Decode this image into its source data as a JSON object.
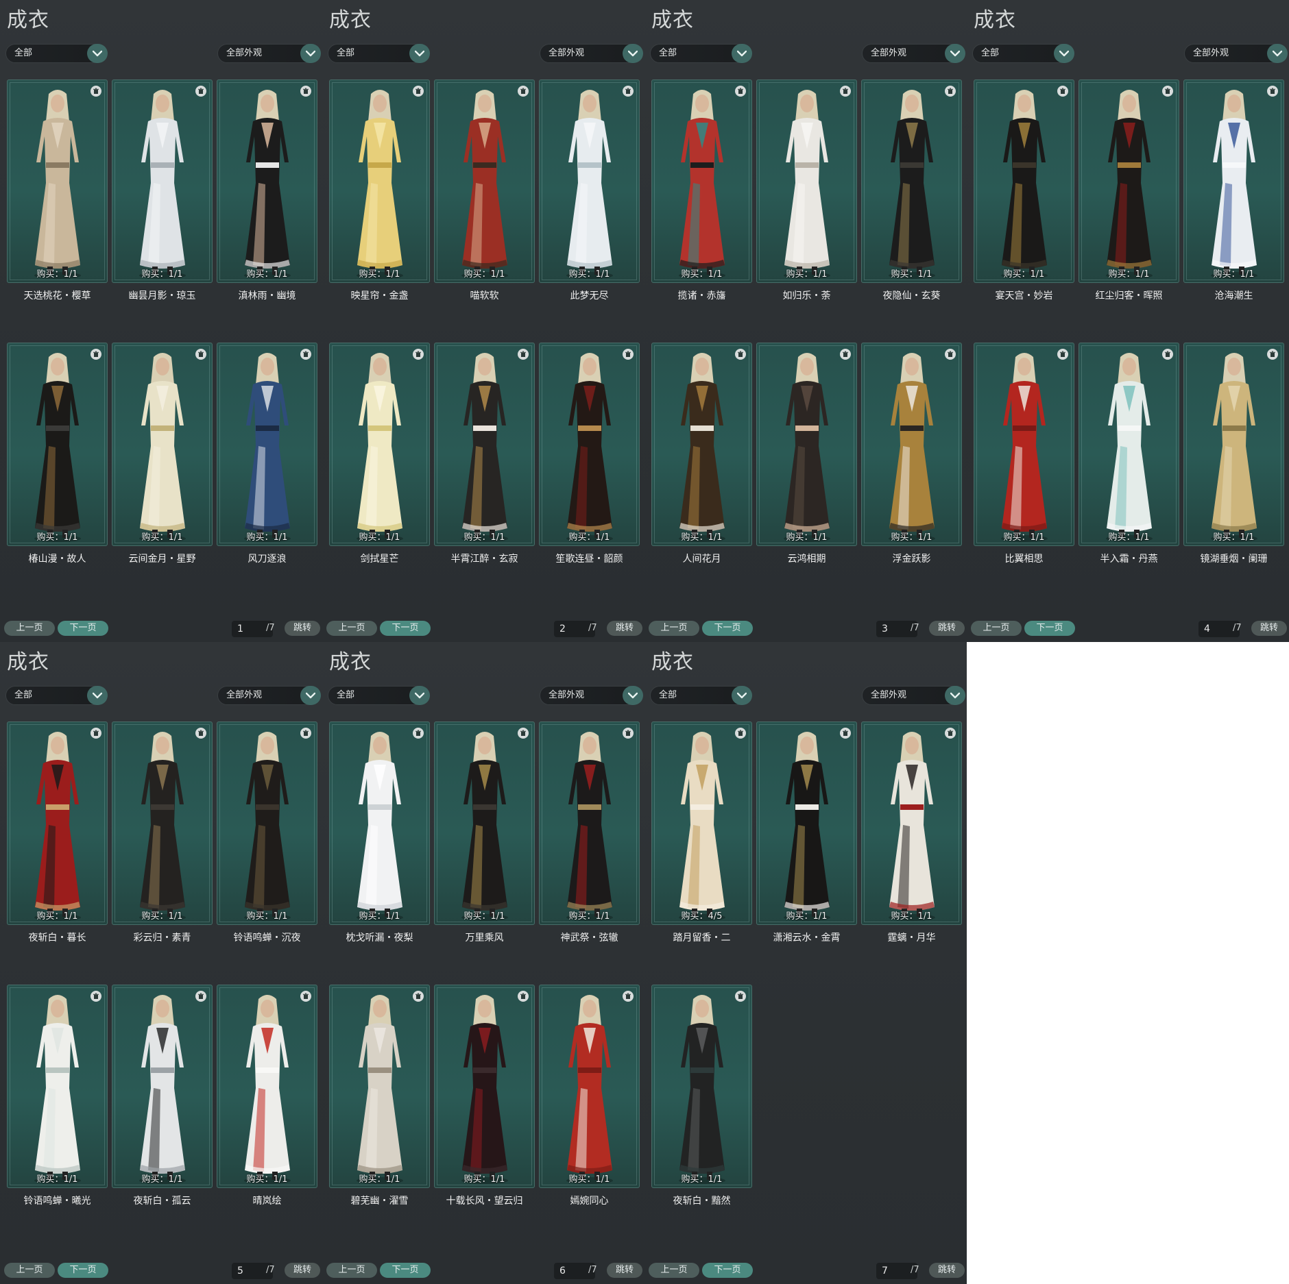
{
  "panels": [
    {
      "title": "成衣",
      "filter_left": "全部",
      "filter_right": "全部外观",
      "items": [
        {
          "name": "天选桃花・樱草",
          "buy": "购买：1/1",
          "palette": [
            "#c9b79b",
            "#e2d5bf",
            "#8a7a62"
          ]
        },
        {
          "name": "幽昙月影・琼玉",
          "buy": "购买：1/1",
          "palette": [
            "#dfe3e6",
            "#f3f5f6",
            "#a9b1b6"
          ]
        },
        {
          "name": "滇林雨・幽境",
          "buy": "购买：1/1",
          "palette": [
            "#1c1c1c",
            "#d9b79c",
            "#e6e6e6"
          ]
        },
        {
          "name": "椿山漫・故人",
          "buy": "购买：1/1",
          "palette": [
            "#1b1a18",
            "#8c6a3a",
            "#3a3a38"
          ]
        },
        {
          "name": "云间金月・星野",
          "buy": "购买：1/1",
          "palette": [
            "#e8e2c8",
            "#f3efdf",
            "#c2b27a"
          ]
        },
        {
          "name": "风刀逐浪",
          "buy": "购买：1/1",
          "palette": [
            "#2f4d7a",
            "#d7dde3",
            "#1b2b44"
          ]
        }
      ],
      "prev_label": "上一页",
      "next_label": "下一页",
      "page": "1",
      "total": "/7",
      "jump_label": "跳转"
    },
    {
      "title": "成衣",
      "filter_left": "全部",
      "filter_right": "全部外观",
      "items": [
        {
          "name": "映星帘・金盏",
          "buy": "购买：1/1",
          "palette": [
            "#e7cf7a",
            "#f4e6a8",
            "#c6a84a"
          ]
        },
        {
          "name": "喵软软",
          "buy": "购买：1/1",
          "palette": [
            "#9b2f24",
            "#d7a98a",
            "#3b2a20"
          ]
        },
        {
          "name": "此梦无尽",
          "buy": "购买：1/1",
          "palette": [
            "#e7ecef",
            "#f6f8f9",
            "#b5c3c9"
          ]
        },
        {
          "name": "剑拭星芒",
          "buy": "购买：1/1",
          "palette": [
            "#efe9c4",
            "#faf6e2",
            "#d4c67c"
          ]
        },
        {
          "name": "半霄江醉・玄寂",
          "buy": "购买：1/1",
          "palette": [
            "#272523",
            "#b08a4a",
            "#e9e3dc"
          ]
        },
        {
          "name": "笙歌连昼・韶颜",
          "buy": "购买：1/1",
          "palette": [
            "#231915",
            "#7a1e1a",
            "#b68a4e"
          ]
        }
      ],
      "prev_label": "上一页",
      "next_label": "下一页",
      "page": "2",
      "total": "/7",
      "jump_label": "跳转"
    },
    {
      "title": "成衣",
      "filter_left": "全部",
      "filter_right": "全部外观",
      "items": [
        {
          "name": "揽诸・赤旛",
          "buy": "购买：1/1",
          "palette": [
            "#b3332c",
            "#2f8a86",
            "#1d1d1d"
          ]
        },
        {
          "name": "如归乐・荼",
          "buy": "购买：1/1",
          "palette": [
            "#e9e7e2",
            "#f7f6f3",
            "#b9b3a8"
          ]
        },
        {
          "name": "夜隐仙・玄葵",
          "buy": "购买：1/1",
          "palette": [
            "#1c1c1c",
            "#8e7a4a",
            "#3a3833"
          ]
        },
        {
          "name": "人间花月",
          "buy": "购买：1/1",
          "palette": [
            "#3a2b1c",
            "#a37a3c",
            "#e5dfd3"
          ]
        },
        {
          "name": "云鸿相期",
          "buy": "购买：1/1",
          "palette": [
            "#2c2623",
            "#5a4a40",
            "#d3b59b"
          ]
        },
        {
          "name": "浮金跃影",
          "buy": "购买：1/1",
          "palette": [
            "#a8823c",
            "#ece8de",
            "#2a2622"
          ]
        }
      ],
      "prev_label": "上一页",
      "next_label": "下一页",
      "page": "3",
      "total": "/7",
      "jump_label": "跳转"
    },
    {
      "title": "成衣",
      "filter_left": "全部",
      "filter_right": "全部外观",
      "items": [
        {
          "name": "宴天宫・妙岩",
          "buy": "购买：1/1",
          "palette": [
            "#1a1918",
            "#a0803c",
            "#3a342a"
          ]
        },
        {
          "name": "红尘归客・晖照",
          "buy": "购买：1/1",
          "palette": [
            "#1d1a18",
            "#8a1e1c",
            "#a07a3a"
          ]
        },
        {
          "name": "沧海潮生",
          "buy": "购买：1/1",
          "palette": [
            "#e9edf1",
            "#3c5a9a",
            "#f6f8fa"
          ]
        },
        {
          "name": "比翼相思",
          "buy": "购买：1/1",
          "palette": [
            "#b3261f",
            "#ece5dc",
            "#7a1a16"
          ]
        },
        {
          "name": "半入霜・丹燕",
          "buy": "购买：1/1",
          "palette": [
            "#e4ece9",
            "#7fc2bd",
            "#f5f7f6"
          ]
        },
        {
          "name": "镜湖垂烟・阑珊",
          "buy": "购买：1/1",
          "palette": [
            "#cdb57c",
            "#e4d6b0",
            "#8c7a4a"
          ]
        }
      ],
      "prev_label": "上一页",
      "next_label": "下一页",
      "page": "4",
      "total": "/7",
      "jump_label": "跳转"
    },
    {
      "title": "成衣",
      "filter_left": "全部",
      "filter_right": "全部外观",
      "items": [
        {
          "name": "夜斩白・暮长",
          "buy": "购买：1/1",
          "palette": [
            "#9b1d1c",
            "#1b1a1a",
            "#c9a06a"
          ]
        },
        {
          "name": "彩云归・素青",
          "buy": "购买：1/1",
          "palette": [
            "#242220",
            "#8a7450",
            "#3c3833"
          ]
        },
        {
          "name": "铃语鸣蝉・沉夜",
          "buy": "购买：1/1",
          "palette": [
            "#1f1c1a",
            "#6a5a3c",
            "#3a342c"
          ]
        },
        {
          "name": "铃语鸣蝉・曦光",
          "buy": "购买：1/1",
          "palette": [
            "#eeefeb",
            "#dfe5e2",
            "#b9c5c0"
          ]
        },
        {
          "name": "夜斩白・孤云",
          "buy": "购买：1/1",
          "palette": [
            "#e3e5e6",
            "#2a2b2c",
            "#9ca2a6"
          ]
        },
        {
          "name": "晴岚绘",
          "buy": "购买：1/1",
          "palette": [
            "#ededea",
            "#c22a22",
            "#f8f8f6"
          ]
        }
      ],
      "prev_label": "上一页",
      "next_label": "下一页",
      "page": "5",
      "total": "/7",
      "jump_label": "跳转"
    },
    {
      "title": "成衣",
      "filter_left": "全部",
      "filter_right": "全部外观",
      "items": [
        {
          "name": "枕戈听漏・夜梨",
          "buy": "购买：1/1",
          "palette": [
            "#f1f2f3",
            "#ffffff",
            "#cdd2d5"
          ]
        },
        {
          "name": "万里乘风",
          "buy": "购买：1/1",
          "palette": [
            "#1d1b1a",
            "#a58a4a",
            "#3a3631"
          ]
        },
        {
          "name": "神武祭・弦辙",
          "buy": "购买：1/1",
          "palette": [
            "#1c1a1a",
            "#9a1e1e",
            "#a08a5a"
          ]
        },
        {
          "name": "碧芜幽・濯雪",
          "buy": "购买：1/1",
          "palette": [
            "#d8d2c6",
            "#ece8e0",
            "#9a9080"
          ]
        },
        {
          "name": "十载长风・望云归",
          "buy": "购买：1/1",
          "palette": [
            "#261618",
            "#8a1c20",
            "#3a2a2c"
          ]
        },
        {
          "name": "嫣婉同心",
          "buy": "购买：1/1",
          "palette": [
            "#b22c22",
            "#efe7dc",
            "#7e1c16"
          ]
        }
      ],
      "prev_label": "上一页",
      "next_label": "下一页",
      "page": "6",
      "total": "/7",
      "jump_label": "跳转"
    },
    {
      "title": "成衣",
      "filter_left": "全部",
      "filter_right": "全部外观",
      "items": [
        {
          "name": "踏月留香・二",
          "buy": "购买：4/5",
          "palette": [
            "#e9dcc3",
            "#c2a060",
            "#f4ede0"
          ]
        },
        {
          "name": "潇湘云水・金霄",
          "buy": "购买：1/1",
          "palette": [
            "#181716",
            "#a28a4e",
            "#eceae5"
          ]
        },
        {
          "name": "霆螭・月华",
          "buy": "购买：1/1",
          "palette": [
            "#e8e4db",
            "#2a2624",
            "#9c1e1e"
          ]
        },
        {
          "name": "夜斩白・黯然",
          "buy": "购买：1/1",
          "palette": [
            "#222323",
            "#5a5c5d",
            "#2d3a3a"
          ]
        }
      ],
      "prev_label": "上一页",
      "next_label": "下一页",
      "page": "7",
      "total": "/7",
      "jump_label": "跳转"
    }
  ]
}
